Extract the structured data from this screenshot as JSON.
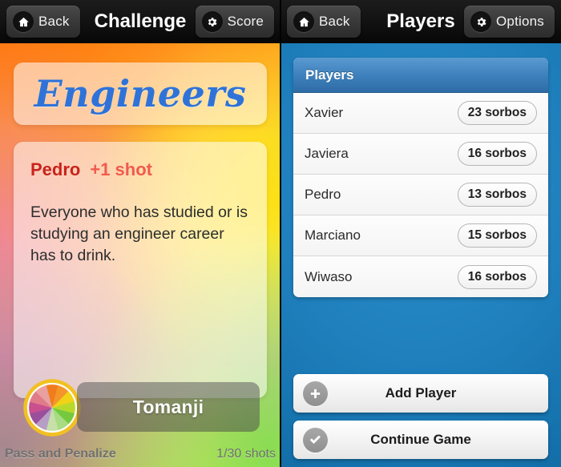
{
  "left": {
    "header": {
      "back_label": "Back",
      "back_icon": "home-icon",
      "title": "Challenge",
      "score_label": "Score",
      "score_icon": "gear-icon"
    },
    "card": {
      "title": "Engineers",
      "title_color": "#2f73d8",
      "player_name": "Pedro",
      "player_name_color": "#c8231c",
      "penalty": "+1 shot",
      "penalty_color": "#f2594f",
      "description": "Everyone who has studied or is studying an engineer career has to drink."
    },
    "brand": {
      "logo_icon": "citrus-wheel-icon",
      "button_label": "Tomanji"
    },
    "footer": {
      "mode_label": "Pass and Penalize",
      "shots_counter": "1/30 shots"
    }
  },
  "right": {
    "header": {
      "back_label": "Back",
      "back_icon": "home-icon",
      "title": "Players",
      "options_label": "Options",
      "options_icon": "gear-icon"
    },
    "list": {
      "header_label": "Players",
      "rows": [
        {
          "name": "Xavier",
          "score": "23 sorbos"
        },
        {
          "name": "Javiera",
          "score": "16 sorbos"
        },
        {
          "name": "Pedro",
          "score": "13 sorbos"
        },
        {
          "name": "Marciano",
          "score": "15 sorbos"
        },
        {
          "name": "Wiwaso",
          "score": "16 sorbos"
        }
      ]
    },
    "actions": {
      "add_player_label": "Add Player",
      "add_player_icon": "plus-circle-icon",
      "continue_label": "Continue Game",
      "continue_icon": "check-circle-icon"
    }
  },
  "theme": {
    "panel_blue": "#1f80bd",
    "list_header_blue": "#3f82bd",
    "topbar_black": "#111111"
  }
}
